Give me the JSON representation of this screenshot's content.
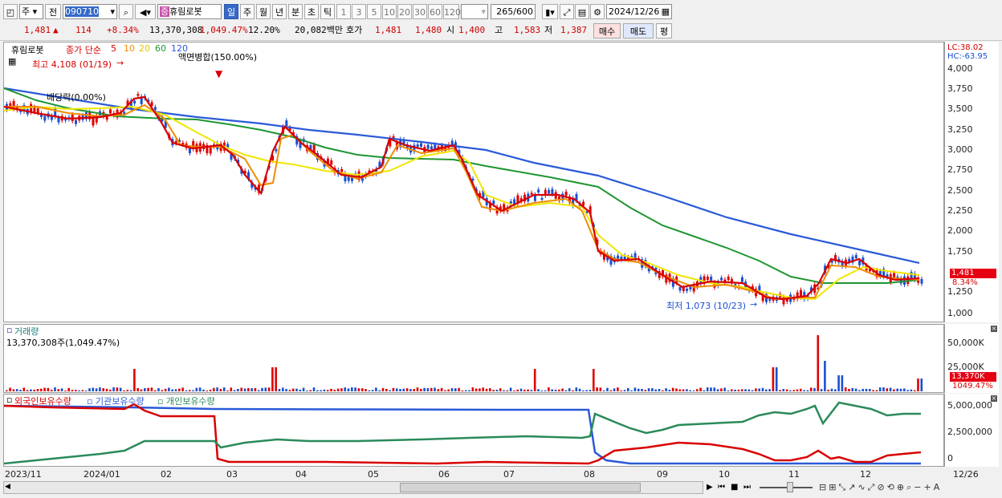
{
  "toolbar": {
    "period_select": "주",
    "prev_label": "전",
    "code": "090710",
    "stock_name": "휴림로봇",
    "badge": "증",
    "periods": [
      "일",
      "주",
      "월",
      "년",
      "분",
      "초",
      "틱"
    ],
    "active_period": "일",
    "minutes": [
      "1",
      "3",
      "5",
      "10",
      "20",
      "30",
      "60",
      "120"
    ],
    "count": "265/600",
    "date": "2024/12/26"
  },
  "quote": {
    "price": "1,481",
    "change": "114",
    "change_pct": "+8.34%",
    "volume": "13,370,308",
    "volume_pct": "1,049.47%",
    "turnover": "12.20%",
    "amount": "20,082백만",
    "ask_label": "호가",
    "ask": "1,481",
    "bid": "1,480",
    "open_label": "시",
    "open": "1,400",
    "high_label": "고",
    "high": "1,583",
    "low_label": "저",
    "low": "1,387",
    "buy_label": "매수",
    "sell_label": "매도",
    "eval_label": "평"
  },
  "price_panel": {
    "name": "휴림로봇",
    "ma_label": "종가 단순",
    "ma_periods": [
      "5",
      "10",
      "20",
      "60",
      "120"
    ],
    "high_annotation": "최고 4,108 (01/19)",
    "low_annotation": "최저 1,073 (10/23)",
    "event_split": "액면병합(150.00%)",
    "event_dividend": "배당락(0.00%)",
    "lc": "LC:38.02",
    "hc": "HC:-63.95",
    "y_ticks": [
      "4,000",
      "3,750",
      "3,500",
      "3,250",
      "3,000",
      "2,750",
      "2,500",
      "2,250",
      "2,000",
      "1,750",
      "1,500",
      "1,250",
      "1,000"
    ],
    "last_tag": "1,481",
    "pct_tag": "8.34%"
  },
  "volume_panel": {
    "title": "거래량",
    "value": "13,370,308주(1,049.47%)",
    "y_ticks": [
      "50,000K",
      "25,000K"
    ],
    "last_tag": "13,370K",
    "pct_tag": "1049.47%"
  },
  "holding_panel": {
    "legends": [
      "외국인보유수량",
      "기관보유수량",
      "개인보유수량"
    ],
    "y_ticks": [
      "5,000,000",
      "2,500,000",
      "0"
    ]
  },
  "x_axis": [
    "2023/11",
    "2024/01",
    "02",
    "03",
    "04",
    "05",
    "06",
    "07",
    "08",
    "09",
    "10",
    "11",
    "12",
    "12/26"
  ],
  "colors": {
    "ma5": "#e00000",
    "ma10": "#f08c00",
    "ma20": "#f0e600",
    "ma60": "#1e9632",
    "ma120": "#2a5ad8",
    "up": "#e00000",
    "down": "#1a4fd0"
  },
  "chart_data": {
    "type": "line",
    "series": [
      {
        "name": "종가 단순 120",
        "x": [
          "2023/11",
          "2024/01",
          "02",
          "03",
          "04",
          "05",
          "06",
          "07",
          "08",
          "09",
          "10",
          "11",
          "12",
          "12/26"
        ],
        "values": [
          3850,
          3700,
          3550,
          3400,
          3250,
          3150,
          3050,
          2900,
          2700,
          2450,
          2150,
          1950,
          1750,
          1600
        ]
      },
      {
        "name": "종가 단순 60",
        "x": [
          "2023/11",
          "2024/01",
          "02",
          "03",
          "04",
          "05",
          "06",
          "07",
          "08",
          "09",
          "10",
          "11",
          "12",
          "12/26"
        ],
        "values": [
          3750,
          3450,
          3350,
          3300,
          3150,
          3050,
          2950,
          2850,
          2650,
          2100,
          1750,
          1500,
          1380,
          1380
        ]
      }
    ]
  }
}
